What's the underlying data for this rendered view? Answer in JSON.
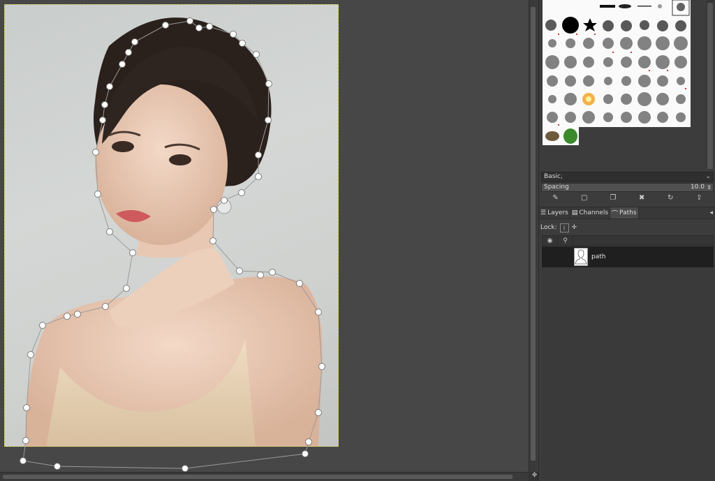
{
  "canvas": {
    "image": "portrait photo of woman with path selection outline",
    "path_stroke_color": "#9a9a9a",
    "anchor_fill_color": "#ffffff"
  },
  "brushes": {
    "set_label": "Basic,",
    "spacing_label": "Spacing",
    "spacing_value": "10.0"
  },
  "dock_tabs": [
    {
      "label": "Layers",
      "icon": "layers-icon"
    },
    {
      "label": "Channels",
      "icon": "channels-icon"
    },
    {
      "label": "Paths",
      "icon": "paths-icon",
      "active": true
    }
  ],
  "paths_panel": {
    "lock_label": "Lock:",
    "items": [
      {
        "name": "path"
      }
    ]
  },
  "colors": {
    "panel_bg": "#3c3c3c",
    "canvas_bg": "#474747",
    "selected_row": "#1f1f1f",
    "selection_border": "#c8c24a"
  }
}
